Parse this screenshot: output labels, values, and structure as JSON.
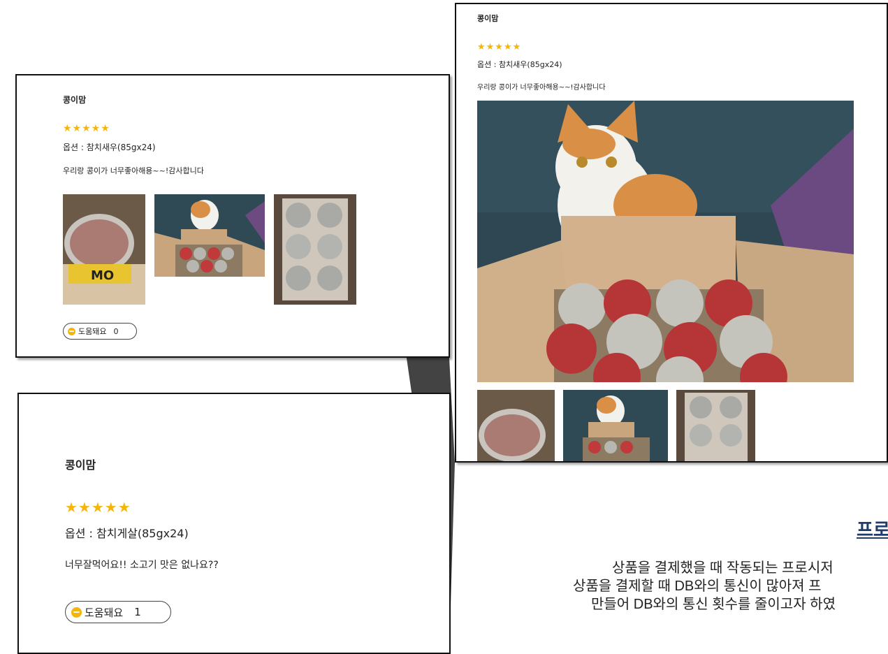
{
  "review_small": {
    "author": "콩이맘",
    "stars": "★★★★★",
    "option": "옵션 : 참치새우(85gx24)",
    "comment": "우리랑 콩이가 너무좋아해용~~!감사합니다",
    "helpful_label": "도움돼요",
    "helpful_count": "0"
  },
  "review_zoom": {
    "author": "콩이맘",
    "stars": "★★★★★",
    "option": "옵션 : 참치새우(85gx24)",
    "comment": "우리랑 콩이가 너무좋아해용~~!감사합니다"
  },
  "review_second": {
    "author": "콩이맘",
    "stars": "★★★★★",
    "option": "옵션 : 참치게살(85gx24)",
    "comment": "너무잘먹어요!! 소고기 맛은 없나요??",
    "helpful_label": "도움돼요",
    "helpful_count": "1"
  },
  "section": {
    "title_partial": "프로",
    "desc_line1": "상품을 결제했을 때 작동되는 프로시저",
    "desc_line2": "상품을 결제할 때 DB와의 통신이 많아져 프",
    "desc_line3": "만들어 DB와의 통신 횟수를 줄이고자 하였"
  },
  "colors": {
    "star": "#f5b50a",
    "title": "#1f3d6b",
    "border": "#111111"
  }
}
